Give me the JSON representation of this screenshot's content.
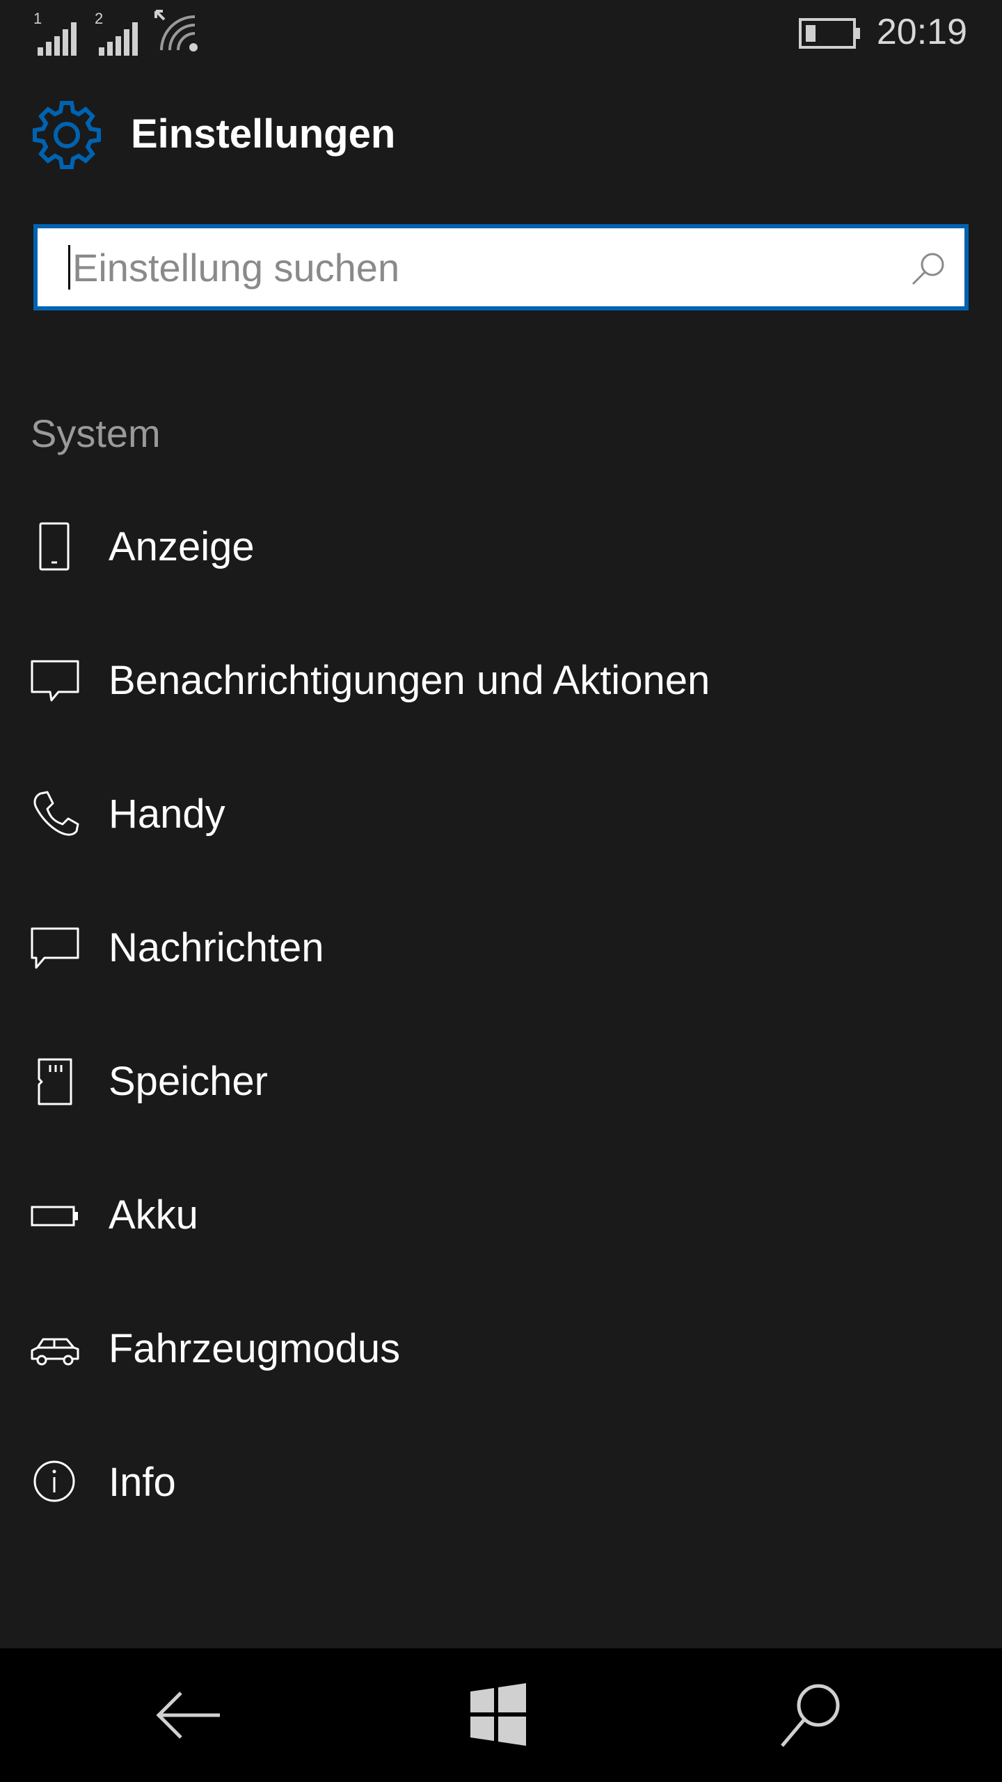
{
  "status_bar": {
    "sim1_label": "1",
    "sim2_label": "2",
    "time": "20:19",
    "icons": [
      "signal-icon",
      "signal-icon",
      "wifi-icon",
      "battery-icon"
    ]
  },
  "header": {
    "title": "Einstellungen",
    "icon": "gear-icon",
    "accent_color": "#0063b1"
  },
  "search": {
    "placeholder": "Einstellung suchen",
    "value": ""
  },
  "section": {
    "label": "System"
  },
  "items": [
    {
      "label": "Anzeige",
      "icon": "phone-display-icon"
    },
    {
      "label": "Benachrichtigungen und Aktionen",
      "icon": "notification-icon"
    },
    {
      "label": "Handy",
      "icon": "phone-call-icon"
    },
    {
      "label": "Nachrichten",
      "icon": "message-icon"
    },
    {
      "label": "Speicher",
      "icon": "sd-card-icon"
    },
    {
      "label": "Akku",
      "icon": "battery-icon"
    },
    {
      "label": "Fahrzeugmodus",
      "icon": "car-icon"
    },
    {
      "label": "Info",
      "icon": "info-icon"
    }
  ],
  "nav_bar": {
    "icons": [
      "back-arrow-icon",
      "windows-icon",
      "search-icon"
    ]
  }
}
